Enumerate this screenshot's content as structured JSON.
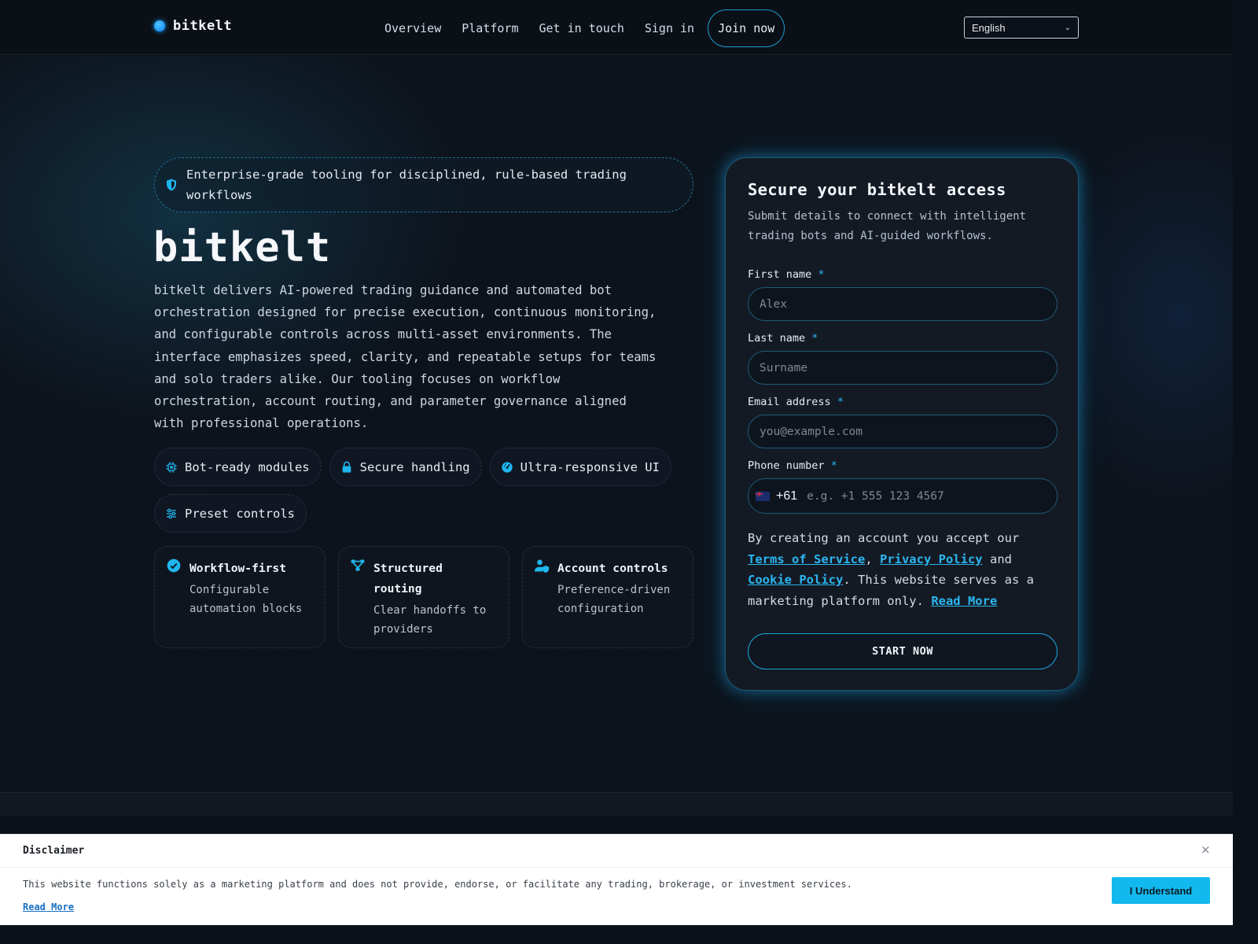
{
  "header": {
    "brand": "bitkelt",
    "nav": [
      "Overview",
      "Platform",
      "Get in touch",
      "Sign in"
    ],
    "join_label": "Join now",
    "language": "English"
  },
  "hero": {
    "badge": "Enterprise-grade tooling for disciplined, rule-based trading workflows",
    "title": "bitkelt",
    "description": "bitkelt delivers AI-powered trading guidance and automated bot orchestration designed for precise execution, continuous monitoring, and configurable controls across multi-asset environments. The interface emphasizes speed, clarity, and repeatable setups for teams and solo traders alike. Our tooling focuses on workflow orchestration, account routing, and parameter governance aligned with professional operations.",
    "chips": [
      {
        "label": "Bot-ready modules",
        "icon": "chip-icon"
      },
      {
        "label": "Secure handling",
        "icon": "lock-icon"
      },
      {
        "label": "Ultra-responsive UI",
        "icon": "gauge-icon"
      },
      {
        "label": "Preset controls",
        "icon": "sliders-icon"
      }
    ],
    "cards": [
      {
        "title": "Workflow-first",
        "desc": "Configurable automation blocks",
        "icon": "check-circle-icon"
      },
      {
        "title": "Structured routing",
        "desc": "Clear handoffs to providers",
        "icon": "route-icon"
      },
      {
        "title": "Account controls",
        "desc": "Preference-driven configuration",
        "icon": "user-shield-icon"
      }
    ]
  },
  "form": {
    "title": "Secure your bitkelt access",
    "subtitle": "Submit details to connect with intelligent trading bots and AI-guided workflows.",
    "first_name_label": "First name",
    "first_name_placeholder": "Alex",
    "last_name_label": "Last name",
    "last_name_placeholder": "Surname",
    "email_label": "Email address",
    "email_placeholder": "you@example.com",
    "phone_label": "Phone number",
    "phone_code": "+61",
    "phone_placeholder": "e.g. +1 555 123 4567",
    "required_mark": "*",
    "terms_prefix": "By creating an account you accept our",
    "terms_link": "Terms of Service",
    "privacy_link": "Privacy Policy",
    "and_text": "and",
    "cookie_link": "Cookie Policy",
    "terms_suffix": ". This website serves as a marketing platform only.",
    "read_more": "Read More",
    "submit_label": "START NOW"
  },
  "disclaimer": {
    "title": "Disclaimer",
    "close": "×",
    "text": "This website functions solely as a marketing platform and does not provide, endorse, or facilitate any trading, brokerage, or investment services.",
    "read_more": "Read More",
    "button": "I Understand"
  },
  "colors": {
    "accent": "#1fb6ef",
    "background": "#0d131c",
    "panel": "#131a24"
  }
}
